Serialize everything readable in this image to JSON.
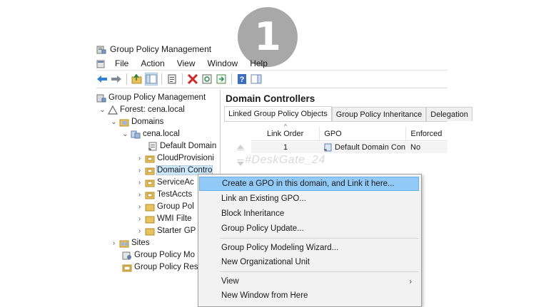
{
  "badge": {
    "number": "1"
  },
  "window": {
    "title": "Group Policy Management"
  },
  "menu": [
    "File",
    "Action",
    "View",
    "Window",
    "Help"
  ],
  "toolbar": [
    "back-icon",
    "forward-icon",
    "up-folder-icon",
    "show-tree-icon",
    "properties-icon",
    "delete-icon",
    "refresh-icon",
    "export-icon",
    "help-icon",
    "show-pane-icon"
  ],
  "tree": {
    "root": "Group Policy Management",
    "forest": "Forest: cena.local",
    "domains": "Domains",
    "domain": "cena.local",
    "items": [
      "Default Domain",
      "CloudProvisioni",
      "Domain Contro",
      "ServiceAc",
      "TestAccts",
      "Group Pol",
      "WMI Filte",
      "Starter GP"
    ],
    "sites": "Sites",
    "modeling": "Group Policy Mo",
    "results": "Group Policy Res"
  },
  "right_pane": {
    "title": "Domain Controllers",
    "tabs": [
      "Linked Group Policy Objects",
      "Group Policy Inheritance",
      "Delegation"
    ],
    "columns": [
      "Link Order",
      "GPO",
      "Enforced"
    ],
    "rows": [
      {
        "link_order": "1",
        "gpo": "Default Domain Con...",
        "enforced": "No"
      }
    ]
  },
  "watermark": "#DeskGate_24",
  "context_menu": {
    "items": [
      "Create a GPO in this domain, and Link it here...",
      "Link an Existing GPO...",
      "Block Inheritance",
      "Group Policy Update...",
      "Group Policy Modeling Wizard...",
      "New Organizational Unit",
      "View",
      "New Window from Here"
    ]
  },
  "colors": {
    "highlight": "#91c9f7",
    "selection": "#cce8ff",
    "folder": "#e8c25c",
    "badge": "#a8a8a8"
  }
}
